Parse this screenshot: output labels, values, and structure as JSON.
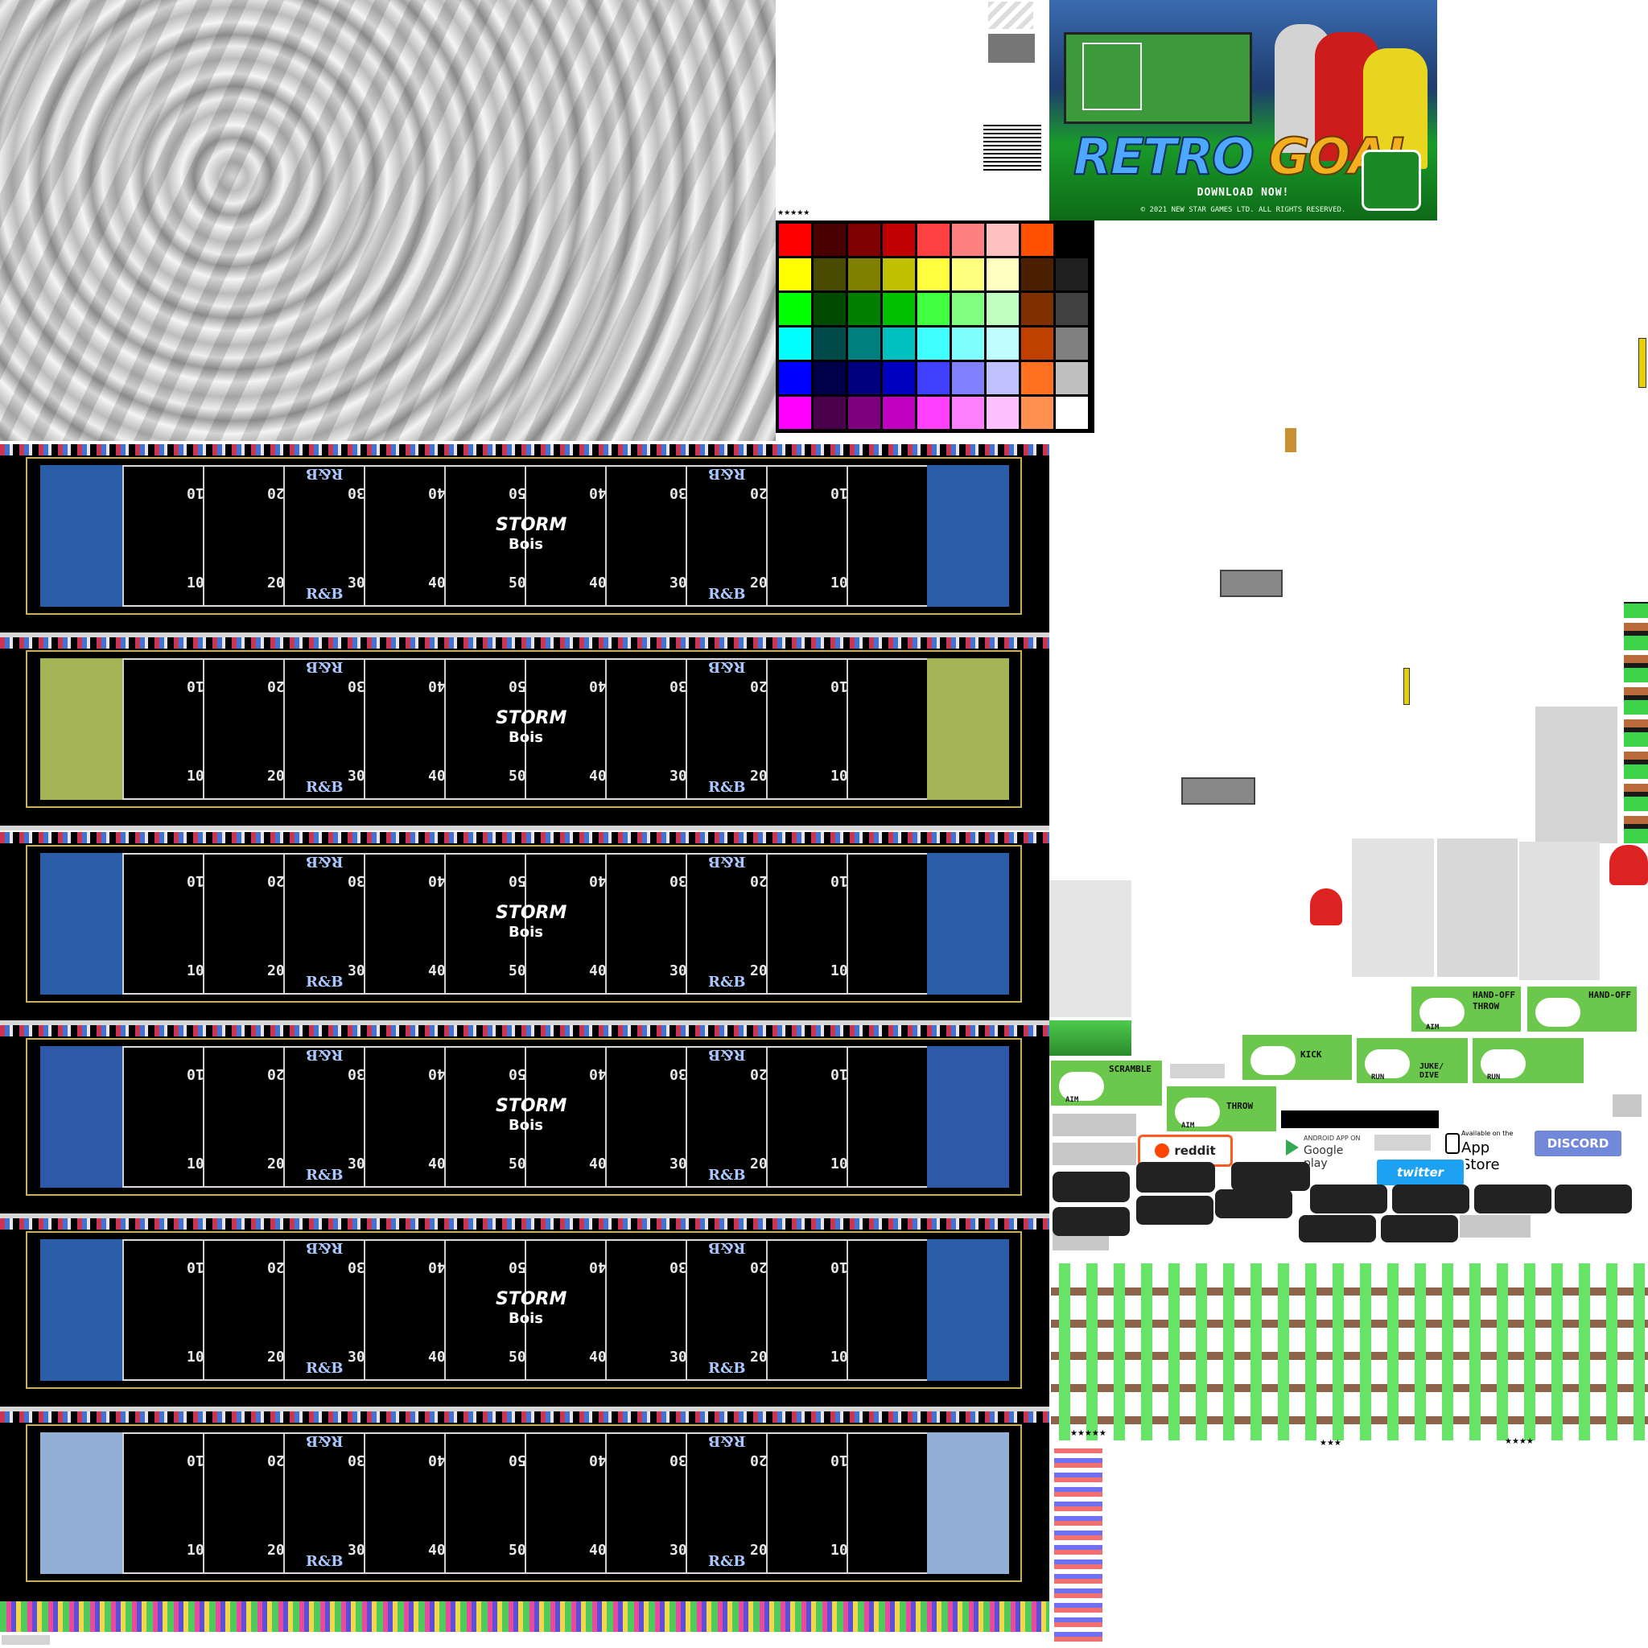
{
  "ad": {
    "title_part1": "RETRO",
    "title_part2": "GOAL",
    "cta": "DOWNLOAD NOW!",
    "copyright": "© 2021 NEW STAR GAMES LTD. ALL RIGHTS RESERVED."
  },
  "palette": {
    "colors": [
      "#ff0000",
      "#4a0000",
      "#7f0000",
      "#c00000",
      "#ff4040",
      "#ff8080",
      "#ffc0c0",
      "#ff5000",
      "#000000",
      "#ffff00",
      "#4a4a00",
      "#7f7f00",
      "#c0c000",
      "#ffff40",
      "#ffff80",
      "#ffffc0",
      "#4a2000",
      "#202020",
      "#00ff00",
      "#004a00",
      "#007f00",
      "#00c000",
      "#40ff40",
      "#80ff80",
      "#c0ffc0",
      "#7f3000",
      "#404040",
      "#00ffff",
      "#004a4a",
      "#007f7f",
      "#00c0c0",
      "#40ffff",
      "#80ffff",
      "#c0ffff",
      "#c04000",
      "#808080",
      "#0000ff",
      "#00004a",
      "#00007f",
      "#0000c0",
      "#4040ff",
      "#8080ff",
      "#c0c0ff",
      "#ff7020",
      "#c0c0c0",
      "#ff00ff",
      "#4a004a",
      "#7f007f",
      "#c000c0",
      "#ff40ff",
      "#ff80ff",
      "#ffc0ff",
      "#ff9050",
      "#ffffff"
    ]
  },
  "fields": [
    {
      "endzone_color": "#2b5ea8",
      "storm": "STORM",
      "bois": "Bois",
      "rb": "R&B"
    },
    {
      "endzone_color": "#a4b456",
      "storm": "STORM",
      "bois": "Bois",
      "rb": "R&B"
    },
    {
      "endzone_color": "#2b5ea8",
      "storm": "STORM",
      "bois": "Bois",
      "rb": "R&B"
    },
    {
      "endzone_color": "#2d59a8",
      "storm": "STORM",
      "bois": "Bois",
      "rb": "R&B"
    },
    {
      "endzone_color": "#2b5ea8",
      "storm": "STORM",
      "bois": "Bois",
      "rb": "R&B"
    },
    {
      "endzone_color": "#94afd6",
      "storm": "",
      "bois": "",
      "rb": "R&B"
    }
  ],
  "yard_lines_top": [
    "10",
    "20",
    "30",
    "40",
    "50",
    "40",
    "30",
    "20",
    "10"
  ],
  "yard_lines_bottom": [
    "10",
    "20",
    "30",
    "40",
    "50",
    "40",
    "30",
    "20",
    "10"
  ],
  "controls": {
    "hand_off": "HAND-OFF",
    "throw": "THROW",
    "aim": "AIM",
    "kick": "KICK",
    "scramble": "SCRAMBLE",
    "run": "RUN",
    "juke_dive": "JUKE/\nDIVE"
  },
  "badges": {
    "reddit": "reddit",
    "google_small": "ANDROID APP ON",
    "google": "Google play",
    "appstore_small": "Available on the",
    "appstore": "App Store",
    "discord": "DISCORD",
    "twitter": "twitter"
  },
  "stars": {
    "a": "★★★★★",
    "b": "★★★",
    "c": "★★★★"
  }
}
